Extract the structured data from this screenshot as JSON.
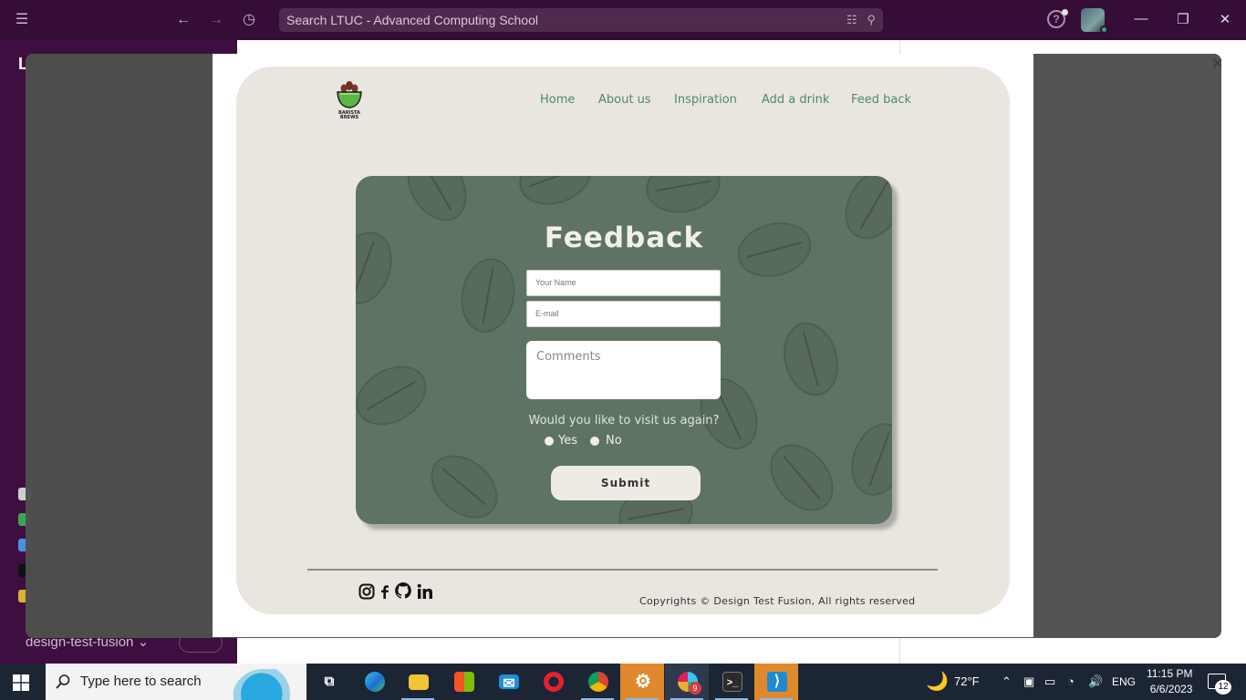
{
  "slack": {
    "search_text": "Search LTUC - Advanced Computing School",
    "workspace_initial": "L",
    "channel_footer": "design-test-fusion",
    "channel_footer_chevron": "⌄",
    "help": "?",
    "icons": [
      "hamburger-icon",
      "back-arrow-icon",
      "forward-arrow-icon",
      "history-icon",
      "filter-icon",
      "search-icon",
      "help-icon",
      "minimize-icon",
      "restore-icon",
      "close-icon"
    ]
  },
  "site": {
    "logo_text": "BARISTA BREWS",
    "nav": [
      "Home",
      "About us",
      "Inspiration",
      "Add a drink",
      "Feed back"
    ],
    "form": {
      "title": "Feedback",
      "name_placeholder": "Your Name",
      "email_placeholder": "E-mail",
      "comments_placeholder": "Comments",
      "question": "Would you like to visit us again?",
      "option_yes": "Yes",
      "option_no": "No",
      "submit": "Submit"
    },
    "footer": {
      "social": [
        "instagram-icon",
        "facebook-icon",
        "github-icon",
        "linkedin-icon"
      ],
      "copyright": "Copyrights © Design Test Fusion, All rights reserved"
    },
    "colors": {
      "page_bg": "#e9e6e0",
      "card_bg": "#5e7361",
      "nav_text": "#4f8a5e"
    }
  },
  "taskbar": {
    "search_placeholder": "Type here to search",
    "apps": [
      "task-view",
      "edge",
      "file-explorer",
      "microsoft-store",
      "mail",
      "opera",
      "chrome",
      "settings",
      "slack",
      "terminal",
      "vscode"
    ],
    "slack_badge": "9",
    "weather": "72°F",
    "language": "ENG",
    "time": "11:15 PM",
    "date": "6/6/2023",
    "notifications": "12"
  }
}
